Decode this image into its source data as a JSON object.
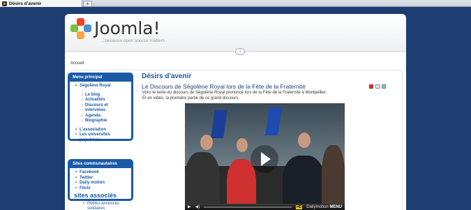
{
  "browser": {
    "tab_title": "Désirs d'avenir",
    "new_tab": "+"
  },
  "header": {
    "logo_text": "Joomla!",
    "tagline": "...because open source matters",
    "toggle": "↕"
  },
  "breadcrumb": "Accueil",
  "sidebar": {
    "menu_title": "Menu principal",
    "menu_items": [
      {
        "label": "Ségolène Royal"
      },
      {
        "label": "Le blog"
      },
      {
        "label": "Actualités"
      },
      {
        "label": "Discours et interviews"
      },
      {
        "label": "Agenda"
      },
      {
        "label": "Biographie"
      },
      {
        "label": "L'association"
      },
      {
        "label": "Les universités populaires"
      }
    ],
    "social_title": "Sites communautaires",
    "social_items": [
      {
        "label": "Facebook"
      },
      {
        "label": "Twitter"
      },
      {
        "label": "Daily motion"
      },
      {
        "label": "Flickr"
      }
    ],
    "assoc_title": "sites associés",
    "assoc_item": "Petites annonces solidaires"
  },
  "main": {
    "heading": "Désirs d'avenir",
    "article_title": "Le Discours de Ségolène Royal lors de la Fête de la Fraternité",
    "intro_line1": "Voici le texte du discours de Ségolène Royal prononcé lors de la Fête de la Fraternité à Montpellier.",
    "intro_line2": "Et en vidéo, la première partie de ce grand discours.",
    "icons": [
      "pdf-icon",
      "print-icon",
      "email-icon"
    ]
  },
  "video": {
    "hd_label": "HD",
    "brand": "Dailymotion",
    "brand_suffix": "MENU"
  },
  "colors": {
    "accent": "#1a5aa6",
    "background": "#1e3d73"
  }
}
